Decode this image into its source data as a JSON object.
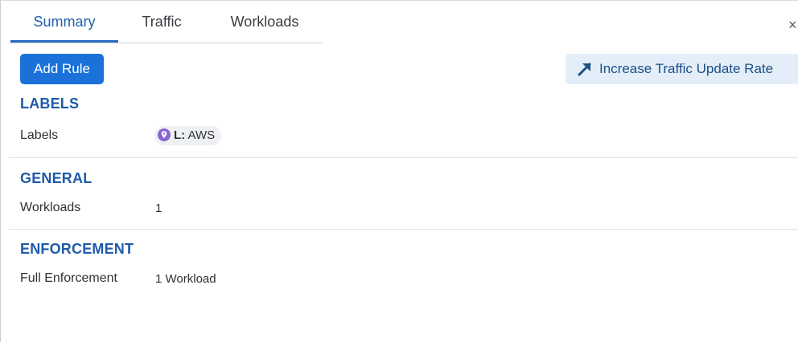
{
  "tabs": [
    {
      "label": "Summary",
      "active": true
    },
    {
      "label": "Traffic",
      "active": false
    },
    {
      "label": "Workloads",
      "active": false
    }
  ],
  "close_label": "×",
  "actions": {
    "add_rule_label": "Add Rule",
    "increase_traffic_label": "Increase Traffic Update Rate",
    "increase_traffic_icon": "arrow-up-right-icon"
  },
  "sections": {
    "labels": {
      "title": "LABELS",
      "row_label": "Labels",
      "chip": {
        "icon": "location-pin-icon",
        "key": "L:",
        "value": "AWS"
      }
    },
    "general": {
      "title": "GENERAL",
      "row_label": "Workloads",
      "row_value": "1"
    },
    "enforcement": {
      "title": "ENFORCEMENT",
      "row_label": "Full Enforcement",
      "row_value": "1 Workload"
    }
  },
  "colors": {
    "accent": "#1a72d9",
    "section_title": "#1e5aa8",
    "chip_icon": "#8a63d2"
  }
}
